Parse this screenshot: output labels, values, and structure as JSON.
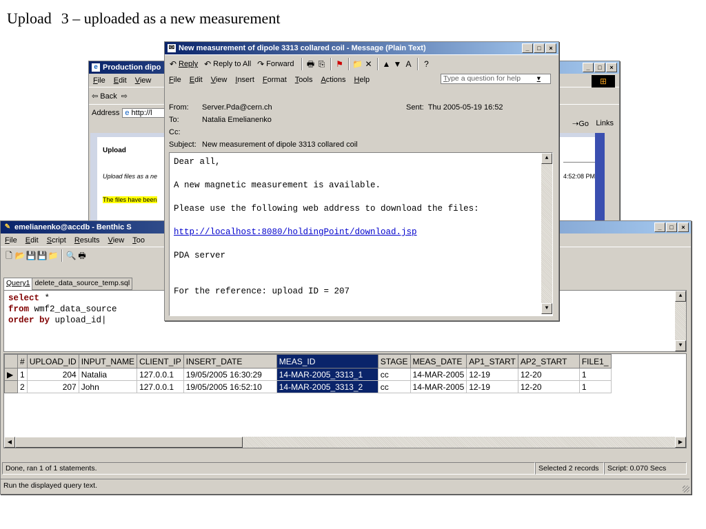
{
  "slide": {
    "word1": "Upload",
    "word2": "3 – uploaded as a new measurement"
  },
  "browser": {
    "title": "Production dipo",
    "menu": [
      "File",
      "Edit",
      "View"
    ],
    "back": "⇦ Back",
    "address_label": "Address",
    "address_value": "http://l",
    "go": "Go",
    "links": "Links",
    "content_heading": "Upload",
    "content_line1": "Upload files as a ne",
    "content_line2": "The files have been",
    "timestamp": "4:52:08 PM"
  },
  "email": {
    "title": "New measurement of dipole 3313 collared coil - Message (Plain Text)",
    "toolbar": {
      "reply": "Reply",
      "reply_all": "Reply to All",
      "forward": "Forward"
    },
    "menu": [
      "File",
      "Edit",
      "View",
      "Insert",
      "Format",
      "Tools",
      "Actions",
      "Help"
    ],
    "help_placeholder": "Type a question for help",
    "from_label": "From:",
    "from_value": "Server.Pda@cern.ch",
    "sent_label": "Sent:",
    "sent_value": "Thu 2005-05-19 16:52",
    "to_label": "To:",
    "to_value": "Natalia Emelianenko",
    "cc_label": "Cc:",
    "subject_label": "Subject:",
    "subject_value": "New measurement of dipole 3313 collared coil",
    "body": {
      "l1": "Dear all,",
      "l2": "A new magnetic measurement is available.",
      "l3": "Please use the following web address to download the files:",
      "l4": "http://localhost:8080/holdingPoint/download.jsp",
      "l5": "PDA server",
      "l6": "For the reference: upload ID = 207"
    }
  },
  "benthic": {
    "title": "emelianenko@accdb - Benthic S",
    "menu": [
      "File",
      "Edit",
      "Script",
      "Results",
      "View",
      "Too"
    ],
    "tabs": [
      "Query1",
      "delete_data_source_temp.sql"
    ],
    "sql": {
      "l1_kw": "select",
      "l1_rest": " *",
      "l2_kw": "from",
      "l2_rest": " wmf2_data_source",
      "l3_kw": "order by",
      "l3_rest": " upload_id"
    },
    "columns": [
      "#",
      "UPLOAD_ID",
      "INPUT_NAME",
      "CLIENT_IP",
      "INSERT_DATE",
      "MEAS_ID",
      "STAGE",
      "MEAS_DATE",
      "AP1_START",
      "AP2_START",
      "FILE1_"
    ],
    "rows": [
      [
        "1",
        "204",
        "Natalia",
        "127.0.0.1",
        "19/05/2005 16:30:29",
        "14-MAR-2005_3313_1",
        "cc",
        "14-MAR-2005",
        "12-19",
        "12-20",
        "1"
      ],
      [
        "2",
        "207",
        "John",
        "127.0.0.1",
        "19/05/2005 16:52:10",
        "14-MAR-2005_3313_2",
        "cc",
        "14-MAR-2005",
        "12-19",
        "12-20",
        "1"
      ]
    ],
    "status_left": "Done, ran 1 of 1 statements.",
    "status_sel": "Selected 2 records",
    "status_time": "Script: 0.070 Secs",
    "bottom_status": "Run the displayed query text."
  }
}
